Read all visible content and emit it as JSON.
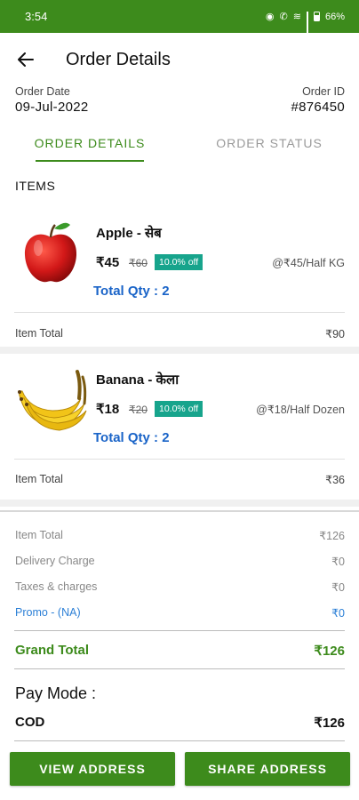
{
  "status_bar": {
    "time": "3:54",
    "battery": "66%"
  },
  "header": {
    "title": "Order Details"
  },
  "order": {
    "date_label": "Order Date",
    "date": "09-Jul-2022",
    "id_label": "Order ID",
    "id": "#876450"
  },
  "tabs": [
    {
      "label": "ORDER DETAILS",
      "active": true
    },
    {
      "label": "ORDER STATUS",
      "active": false
    }
  ],
  "items_heading": "ITEMS",
  "items": [
    {
      "name": "Apple - सेब",
      "price": "₹45",
      "mrp": "₹60",
      "discount": "10.0% off",
      "unit_price": "@₹45/Half KG",
      "qty": "Total Qty : 2",
      "total_label": "Item Total",
      "total": "₹90",
      "icon": "apple-image"
    },
    {
      "name": "Banana - केला",
      "price": "₹18",
      "mrp": "₹20",
      "discount": "10.0% off",
      "unit_price": "@₹18/Half Dozen",
      "qty": "Total Qty : 2",
      "total_label": "Item Total",
      "total": "₹36",
      "icon": "banana-image"
    }
  ],
  "summary": {
    "item_total_label": "Item Total",
    "item_total": "₹126",
    "delivery_label": "Delivery Charge",
    "delivery": "₹0",
    "taxes_label": "Taxes & charges",
    "taxes": "₹0",
    "promo_label": "Promo - (NA)",
    "promo": "₹0",
    "grand_label": "Grand Total",
    "grand": "₹126"
  },
  "pay_mode": {
    "title": "Pay Mode :",
    "method": "COD",
    "amount": "₹126"
  },
  "buttons": {
    "view_address": "VIEW ADDRESS",
    "share_address": "SHARE ADDRESS"
  },
  "colors": {
    "brand": "#3d8b1c",
    "badge": "#17a48c",
    "qty": "#1a64c8",
    "promo": "#2b7fd6"
  }
}
